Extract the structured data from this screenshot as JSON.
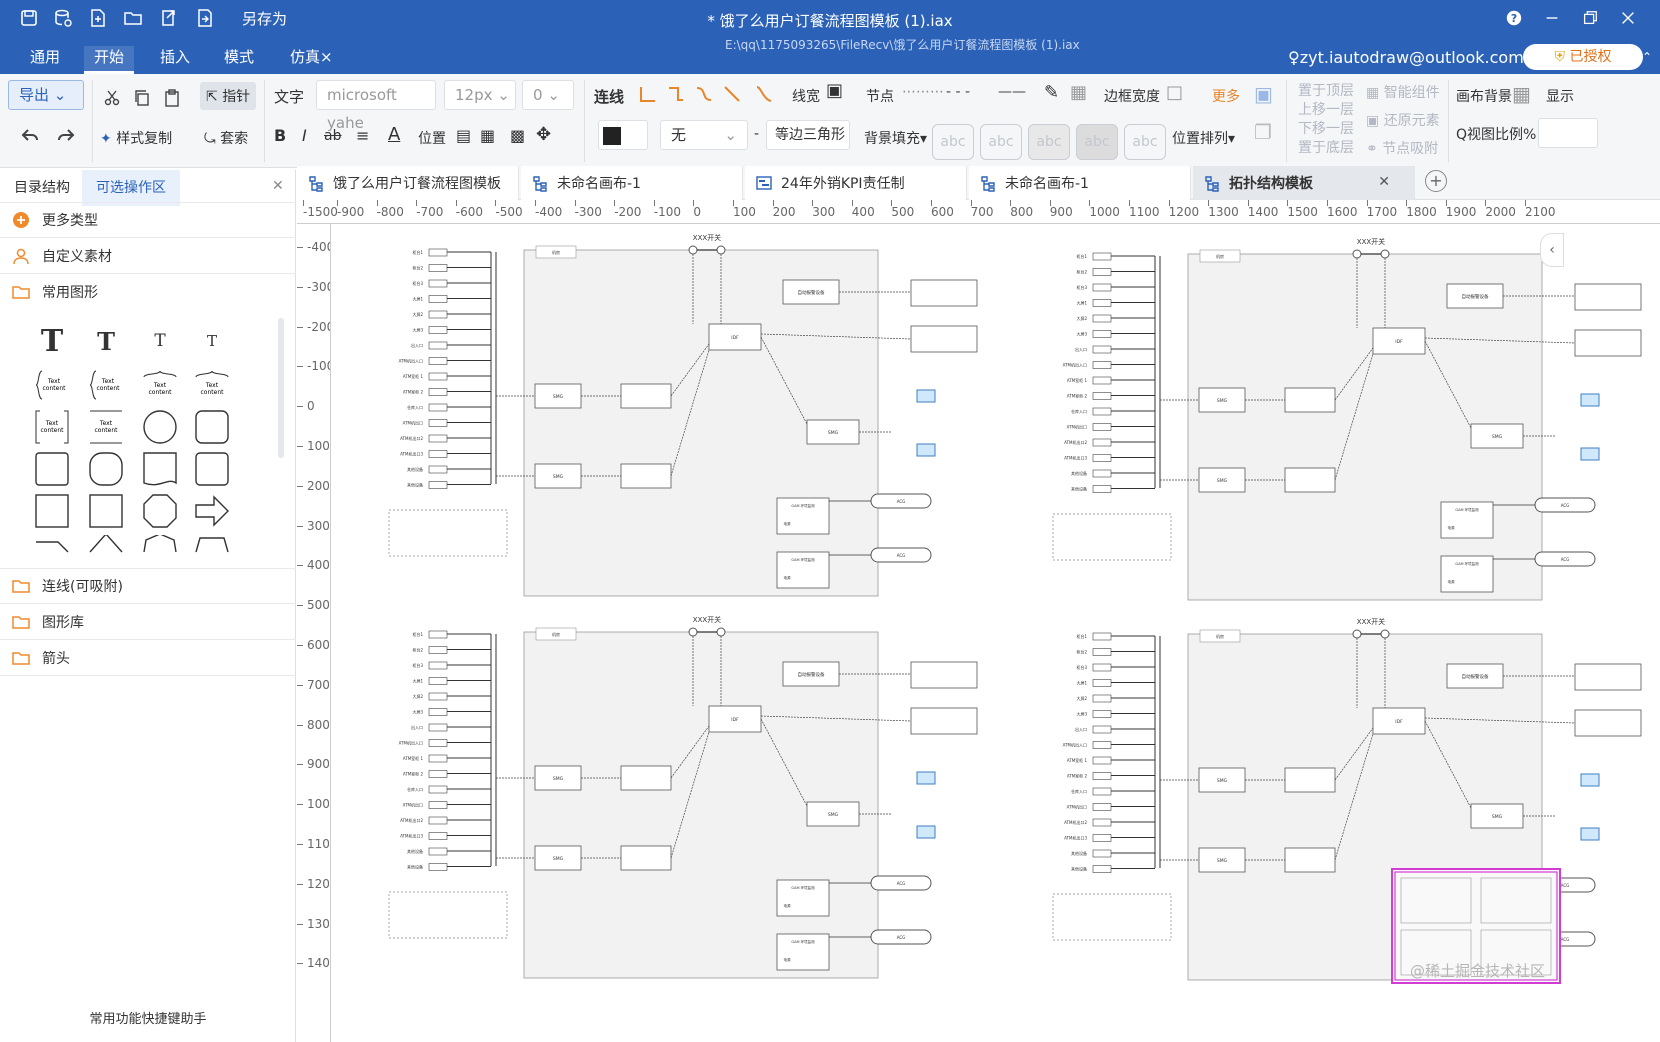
{
  "titlebar": {
    "save_as": "另存为",
    "doc_title": "*  饿了么用户订餐流程图模板 (1).iax",
    "path": "E:\\qq\\1175093265\\FileRecv\\饿了么用户订餐流程图模板 (1).iax"
  },
  "menu": {
    "tabs": [
      "通用",
      "开始",
      "插入",
      "模式",
      "仿真×"
    ],
    "user": "♀zyt.iautodraw@outlook.com",
    "license": "已授权"
  },
  "toolbar": {
    "export": "导出",
    "pointer": "指针",
    "style_copy": "样式复制",
    "lasso": "套索",
    "text_label": "文字",
    "font": "microsoft yahe",
    "font_size": "12px",
    "spacing": "0",
    "connect": "连线",
    "line_width": "线宽",
    "node": "节点",
    "border_width": "边框宽度",
    "more": "更多",
    "to_top": "置于顶层",
    "up_one": "上移一层",
    "down_one": "下移一层",
    "to_bottom": "置于底层",
    "smart": "智能组件",
    "restore": "还原元素",
    "node_snap": "节点吸附",
    "canvas_bg": "画布背景",
    "display": "显示",
    "view_ratio": "Q视图比例%",
    "position": "位置",
    "none": "无",
    "triangle": "等边三角形",
    "bg_fill": "背景填充▾",
    "arrange": "位置排列▾",
    "abc": "abc"
  },
  "leftpanel": {
    "tabs": [
      "目录结构",
      "可选操作区"
    ],
    "more_types": "更多类型",
    "custom": "自定义素材",
    "common": "常用图形",
    "lines": "连线(可吸附)",
    "library": "图形库",
    "arrows": "箭头",
    "helper": "常用功能快捷键助手",
    "text_content": "Text content"
  },
  "doctabs": [
    "饿了么用户订餐流程图模板",
    "未命名画布-1",
    "24年外销KPI责任制",
    "未命名画布-1",
    "拓扑结构模板"
  ],
  "ruler": {
    "h": [
      "-1500",
      "-900",
      "-800",
      "-700",
      "-600",
      "-500",
      "-400",
      "-300",
      "-200",
      "-100",
      "0",
      "100",
      "200",
      "300",
      "400",
      "500",
      "600",
      "700",
      "800",
      "900",
      "1000",
      "1100",
      "1200",
      "1300",
      "1400",
      "1500",
      "1600",
      "1700",
      "1800",
      "1900",
      "2000",
      "2100"
    ],
    "v": [
      "-400",
      "-300",
      "-200",
      "-100",
      "0",
      "100",
      "200",
      "300",
      "400",
      "500",
      "600",
      "700",
      "800",
      "900",
      "1000",
      "1100",
      "1200",
      "1300",
      "1400"
    ]
  },
  "diagram": {
    "switch": "XXX开关",
    "room": "机房",
    "alarm": "自动报警设备",
    "idf": "IDF",
    "smg": "SMG",
    "gam": "GAM 环境监测",
    "acg": "ACG",
    "power": "电源",
    "left_labels": [
      "柜台1",
      "柜台2",
      "柜台3",
      "大屏1",
      "大屏2",
      "大屏3",
      "出入口",
      "ATM机出入口",
      "ATM室柜 1",
      "ATM室柜 2",
      "仓库入口",
      "ATM机出口",
      "ATM机出口2",
      "ATM机出口3",
      "其他设备",
      "其他设备"
    ]
  },
  "watermark": "@稀土掘金技术社区"
}
